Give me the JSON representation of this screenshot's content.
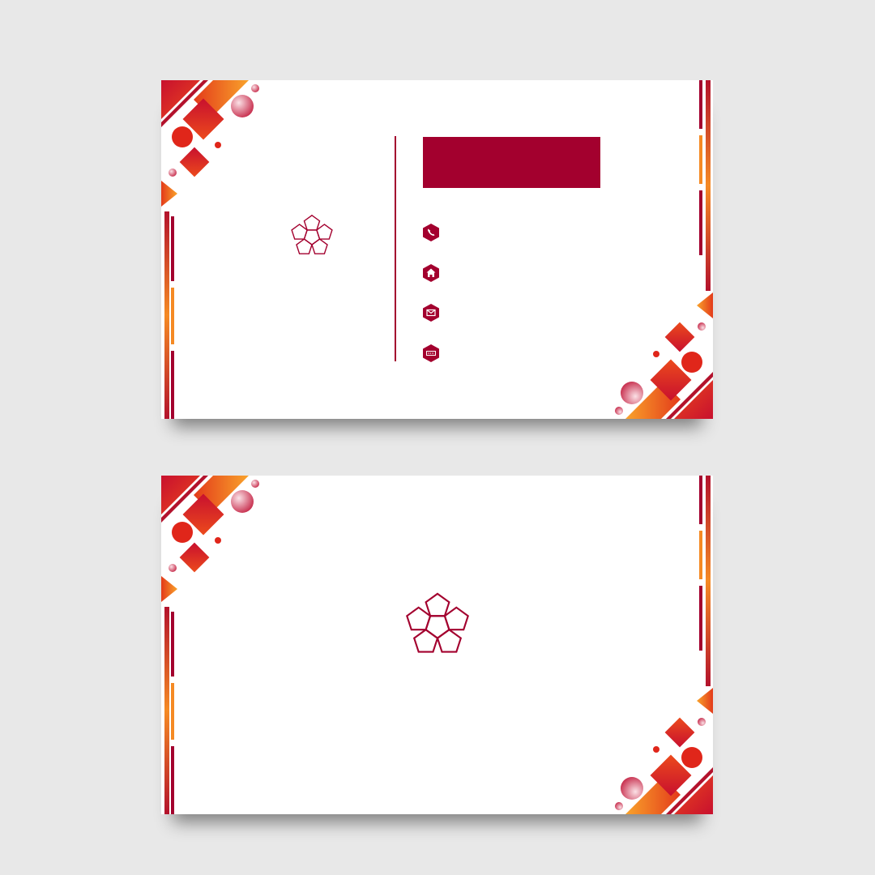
{
  "colors": {
    "primary": "#a3002e",
    "accent_red": "#e0261a",
    "accent_orange": "#f59a2a",
    "accent_pink": "#d9536b",
    "card": "#ffffff",
    "background": "#e8e8e8"
  },
  "front": {
    "logo_icon": "pentagon-cluster-icon",
    "name_bar": "",
    "contacts": [
      {
        "icon": "phone-icon",
        "text": ""
      },
      {
        "icon": "home-icon",
        "text": ""
      },
      {
        "icon": "mail-icon",
        "text": ""
      },
      {
        "icon": "web-icon",
        "text": ""
      }
    ]
  },
  "back": {
    "logo_icon": "pentagon-cluster-icon"
  }
}
